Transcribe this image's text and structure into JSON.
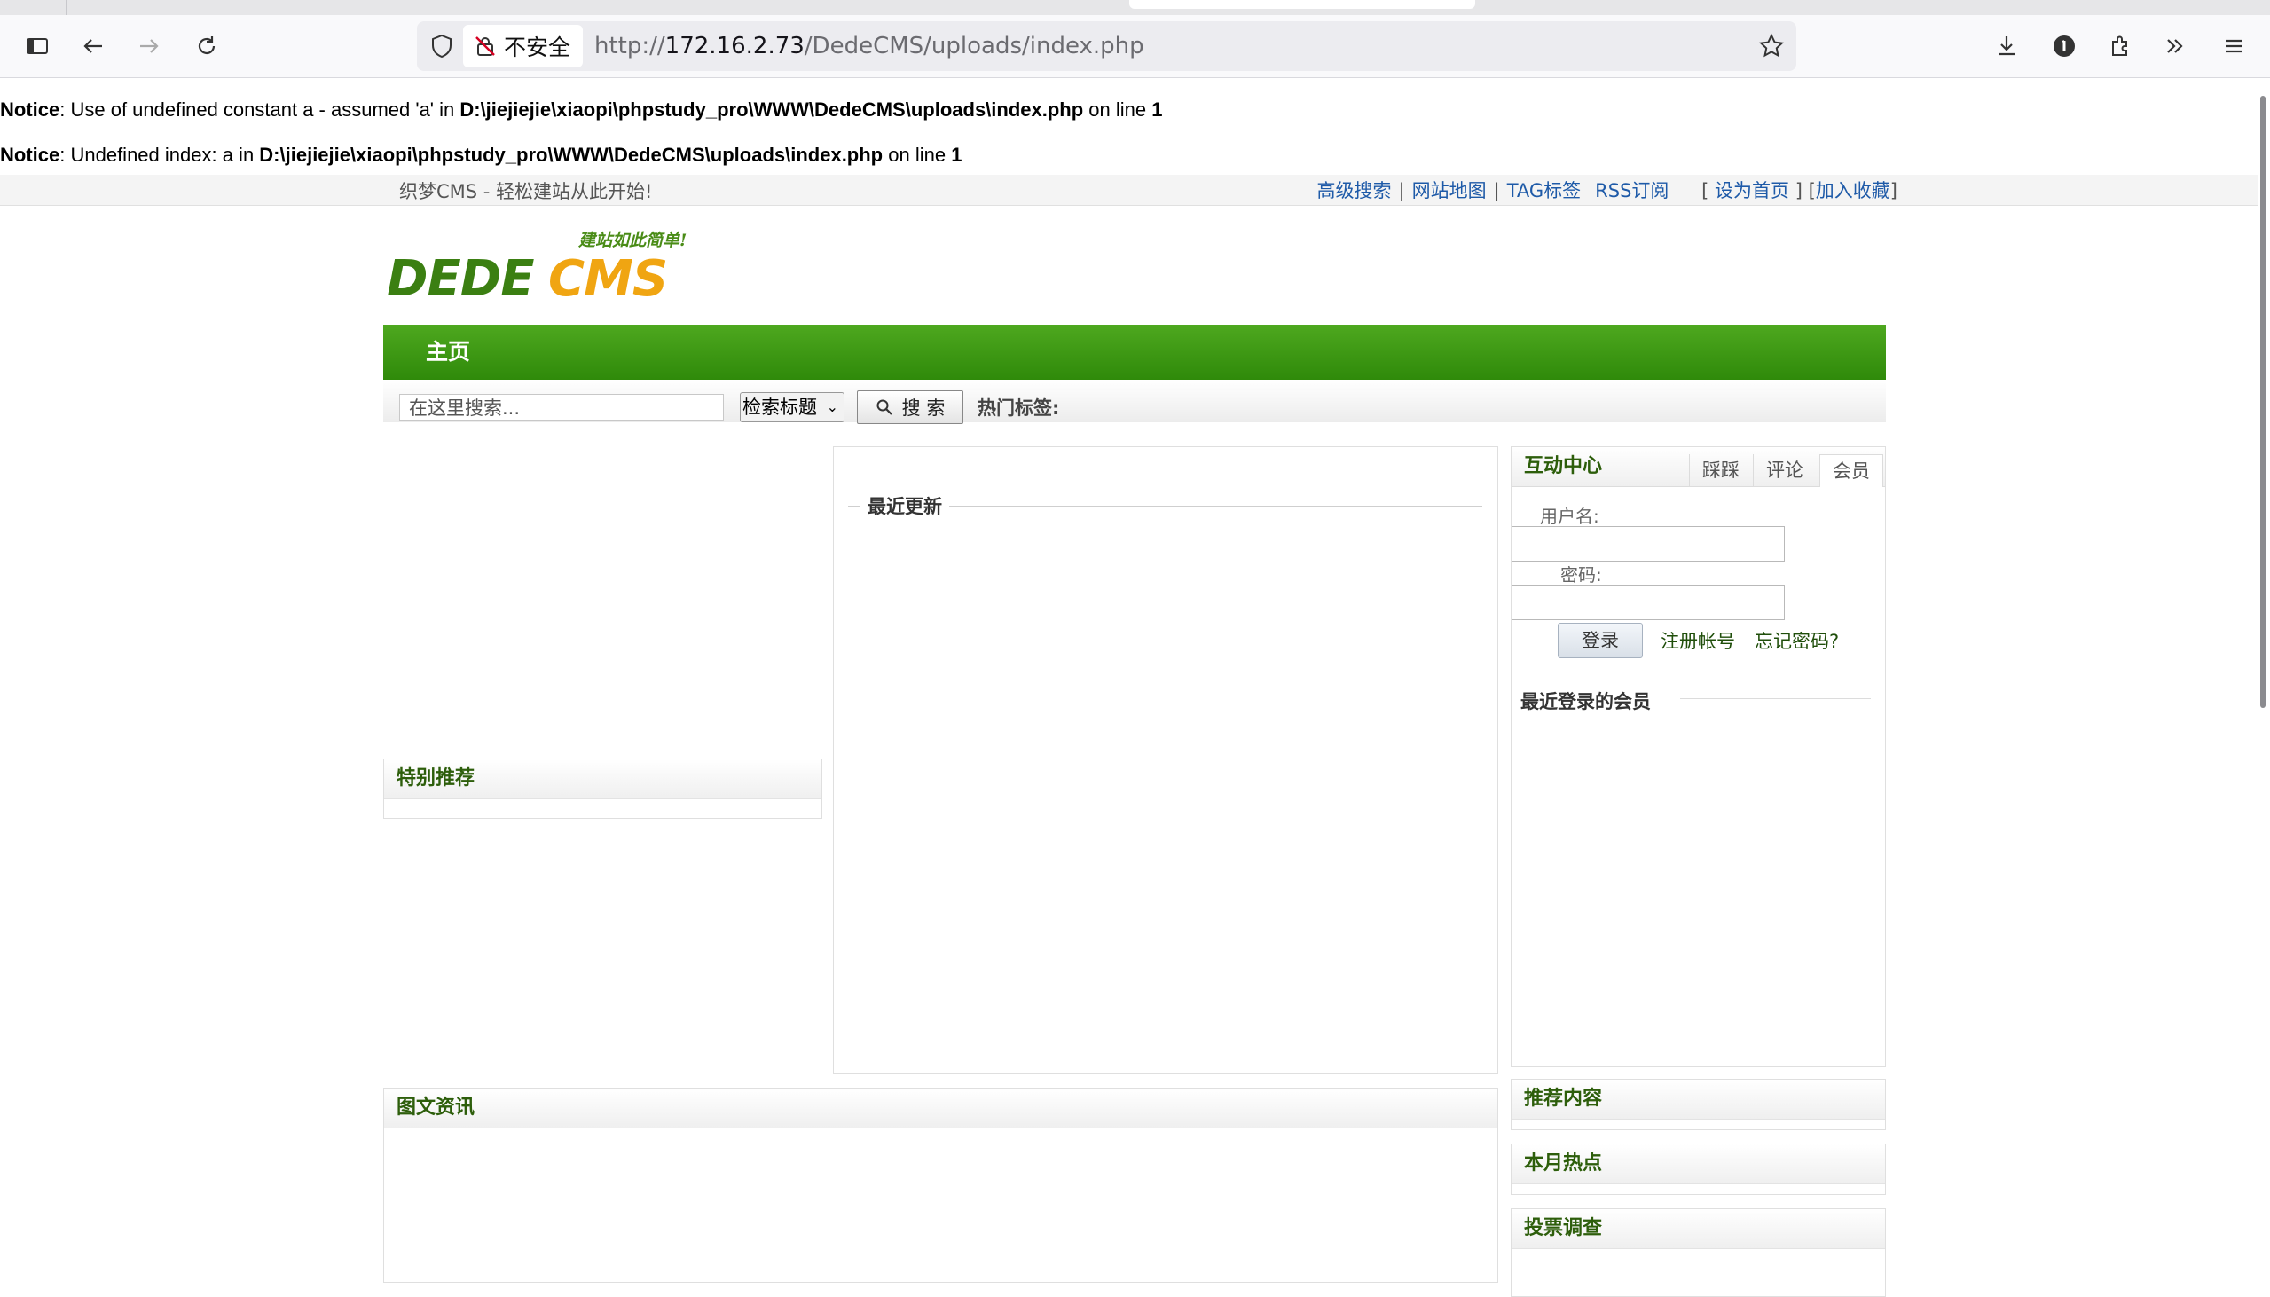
{
  "browser": {
    "url_prefix": "http://",
    "url_host": "172.16.2.73",
    "url_path": "/DedeCMS/uploads/index.php",
    "security_label": "不安全"
  },
  "notices": [
    {
      "label": "Notice",
      "text_a": ": Use of undefined constant a - assumed 'a' in ",
      "path": "D:\\jiejiejie\\xiaopi\\phpstudy_pro\\WWW\\DedeCMS\\uploads\\index.php",
      "text_b": " on line ",
      "line": "1"
    },
    {
      "label": "Notice",
      "text_a": ": Undefined index: a in ",
      "path": "D:\\jiejiejie\\xiaopi\\phpstudy_pro\\WWW\\DedeCMS\\uploads\\index.php",
      "text_b": " on line ",
      "line": "1"
    }
  ],
  "topbar": {
    "slogan": "织梦CMS - 轻松建站从此开始!",
    "links": [
      "高级搜索",
      "网站地图",
      "TAG标签",
      "RSS订阅"
    ],
    "bracket_open": "[",
    "bracket_close": "]",
    "set_home": "设为首页",
    "add_favorite": "加入收藏"
  },
  "logo": {
    "text": "DEDECMS",
    "tagline": "建站如此简单!"
  },
  "nav": {
    "home": "主页"
  },
  "search": {
    "placeholder": "在这里搜索...",
    "select_value": "检索标题",
    "button": "搜 索",
    "hot_tags_label": "热门标签:"
  },
  "left": {
    "special_title": "特别推荐"
  },
  "center": {
    "recent_title": "最近更新"
  },
  "right": {
    "title": "互动中心",
    "tabs": [
      "踩踩",
      "评论",
      "会员"
    ],
    "username_label": "用户名:",
    "password_label": "密码:",
    "login_button": "登录",
    "register_link": "注册帐号",
    "forgot_link": "忘记密码?",
    "recent_members": "最近登录的会员"
  },
  "bottom": {
    "photo_news": "图文资讯",
    "recommended": "推荐内容",
    "monthly_hot": "本月热点",
    "poll": "投票调查"
  },
  "colors": {
    "nav_green": "#3a9612",
    "title_green": "#2d5e0b",
    "link_blue": "#1e5aa8"
  }
}
